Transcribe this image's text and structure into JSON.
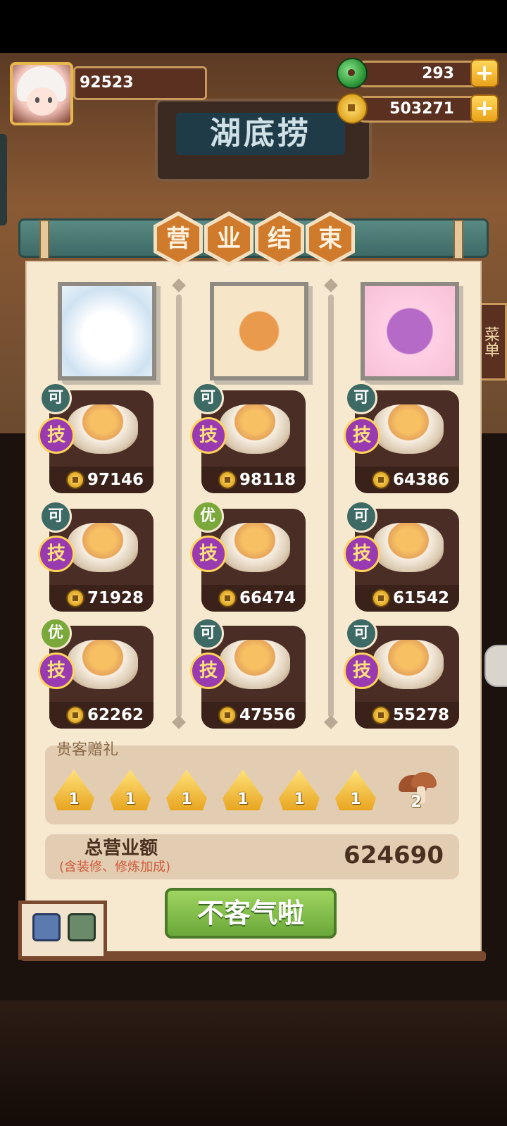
{
  "header": {
    "player_score": "92523",
    "jade": "293",
    "coins": "503271",
    "sign_text": "湖底捞"
  },
  "title_chars": [
    "营",
    "业",
    "结",
    "束"
  ],
  "side_menu_label": "菜单",
  "columns": [
    {
      "portrait": "white-cat-portrait",
      "dishes": [
        {
          "rank": "可",
          "skill": "技",
          "value": "97146"
        },
        {
          "rank": "可",
          "skill": "技",
          "value": "71928"
        },
        {
          "rank": "优",
          "skill": "技",
          "value": "62262"
        }
      ]
    },
    {
      "portrait": "orange-cat-portrait",
      "dishes": [
        {
          "rank": "可",
          "skill": "技",
          "value": "98118"
        },
        {
          "rank": "优",
          "skill": "技",
          "value": "66474"
        },
        {
          "rank": "可",
          "skill": "技",
          "value": "47556"
        }
      ]
    },
    {
      "portrait": "purple-girl-portrait",
      "dishes": [
        {
          "rank": "可",
          "skill": "技",
          "value": "64386"
        },
        {
          "rank": "可",
          "skill": "技",
          "value": "61542"
        },
        {
          "rank": "可",
          "skill": "技",
          "value": "55278"
        }
      ]
    }
  ],
  "gifts": {
    "title": "贵客赠礼",
    "items": [
      {
        "icon": "golden-zongzi-icon",
        "count": "1"
      },
      {
        "icon": "golden-zongzi-icon",
        "count": "1"
      },
      {
        "icon": "golden-zongzi-icon",
        "count": "1"
      },
      {
        "icon": "golden-zongzi-icon",
        "count": "1"
      },
      {
        "icon": "golden-zongzi-icon",
        "count": "1"
      },
      {
        "icon": "golden-zongzi-icon",
        "count": "1"
      },
      {
        "icon": "mushroom-icon",
        "count": "2"
      }
    ]
  },
  "total": {
    "label": "总营业额",
    "sub_label": "(含装修、修炼加成)",
    "value": "624690"
  },
  "confirm_button": "不客气啦",
  "colors": {
    "panel": "#f7e8d0",
    "card": "#4a2d24",
    "title_hex": "#d07a2c",
    "button": "#7ab84a",
    "skill_badge": "#9a3ab0"
  }
}
